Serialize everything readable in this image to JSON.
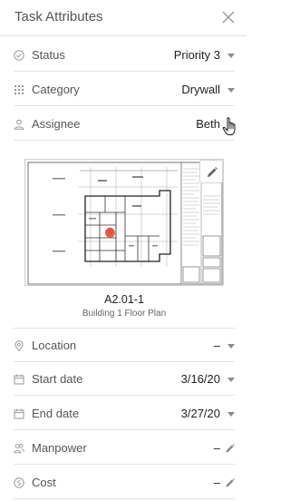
{
  "header": {
    "title": "Task Attributes"
  },
  "fields": {
    "status": {
      "label": "Status",
      "value": "Priority 3"
    },
    "category": {
      "label": "Category",
      "value": "Drywall"
    },
    "assignee": {
      "label": "Assignee",
      "value": "Beth"
    },
    "location": {
      "label": "Location",
      "value": "–"
    },
    "start_date": {
      "label": "Start date",
      "value": "3/16/20"
    },
    "end_date": {
      "label": "End date",
      "value": "3/27/20"
    },
    "manpower": {
      "label": "Manpower",
      "value": "–"
    },
    "cost": {
      "label": "Cost",
      "value": "–"
    }
  },
  "sheet": {
    "number": "A2.01-1",
    "name": "Building 1 Floor Plan"
  },
  "colors": {
    "pin": "#e5533c",
    "caret": "#8a8a8a",
    "divider": "#e4e4e4"
  }
}
